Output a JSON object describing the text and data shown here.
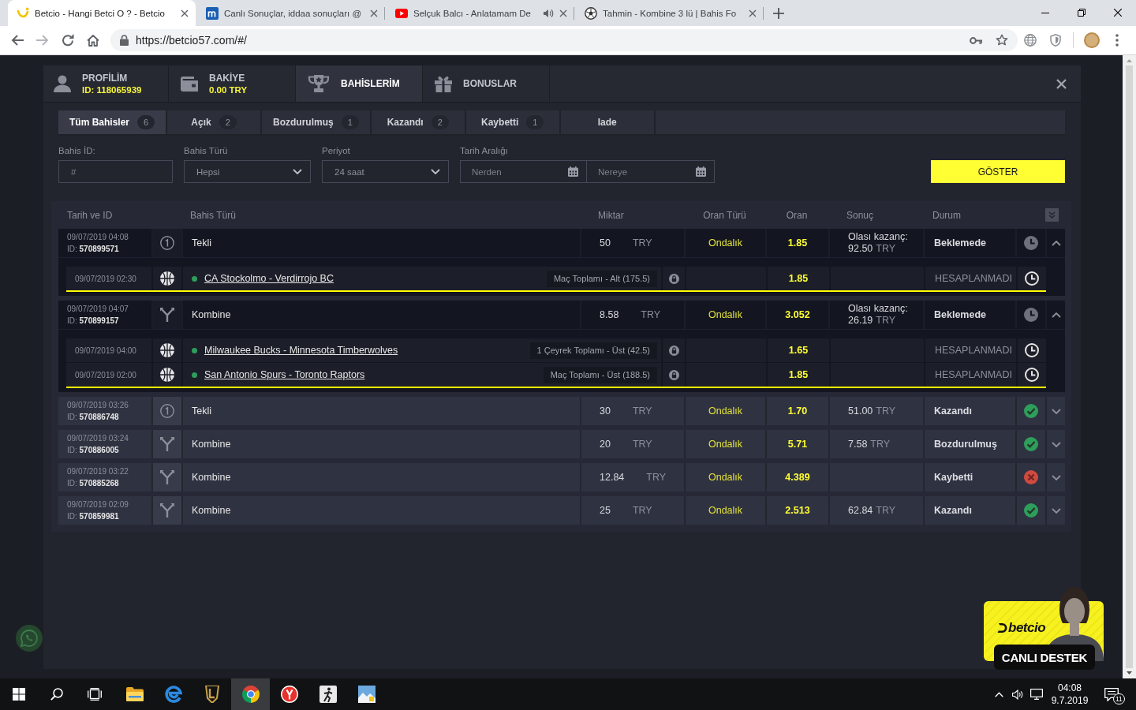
{
  "browser": {
    "tabs": [
      {
        "title": "Betcio - Hangi Betci O ? - Betcio",
        "selected": true,
        "audio": false
      },
      {
        "title": "Canlı Sonuçlar, iddaa sonuçları @",
        "selected": false,
        "audio": false
      },
      {
        "title": "Selçuk Balcı - Anlatamam De",
        "selected": false,
        "audio": true
      },
      {
        "title": "Tahmin - Kombine 3 lü | Bahis Fo",
        "selected": false,
        "audio": false
      }
    ],
    "url": "https://betcio57.com/#/"
  },
  "modal": {
    "nav": [
      {
        "label": "PROFİLİM",
        "detail": "ID: 118065939",
        "selected": false
      },
      {
        "label": "BAKİYE",
        "detail": "0.00 TRY",
        "selected": false
      },
      {
        "label": "BAHİSLERİM",
        "selected": true
      },
      {
        "label": "BONUSLAR",
        "selected": false
      }
    ],
    "bet_tabs": [
      {
        "label": "Tüm Bahisler",
        "count": "6",
        "selected": true
      },
      {
        "label": "Açık",
        "count": "2",
        "selected": false
      },
      {
        "label": "Bozdurulmuş",
        "count": "1",
        "selected": false
      },
      {
        "label": "Kazandı",
        "count": "2",
        "selected": false
      },
      {
        "label": "Kaybetti",
        "count": "1",
        "selected": false
      },
      {
        "label": "Iade",
        "selected": false
      }
    ],
    "filters": {
      "bet_id": {
        "label": "Bahis İD:",
        "placeholder": "#"
      },
      "bet_type": {
        "label": "Bahis Türü",
        "value": "Hepsi"
      },
      "period": {
        "label": "Periyot",
        "value": "24 saat"
      },
      "date_range": {
        "label": "Tarih Aralığı",
        "from_placeholder": "Nerden",
        "to_placeholder": "Nereye"
      },
      "show_button": "GÖSTER"
    },
    "table": {
      "columns": [
        "Tarih ve ID",
        "Bahis Türü",
        "Miktar",
        "Oran Türü",
        "Oran",
        "Sonuç",
        "Durum"
      ],
      "rows": [
        {
          "date": "09/07/2019 04:08",
          "id": "ID: **570899571**",
          "kind": "single",
          "type": "Tekli",
          "amount": "50",
          "currency": "TRY",
          "odds_type": "Ondalık",
          "odds": "1.85",
          "result": {
            "label": "Olası kazanç:",
            "amount": "92.50",
            "currency": "TRY"
          },
          "status": {
            "text": "Beklemede",
            "kind": "pending"
          },
          "expanded": true,
          "selections": [
            {
              "date": "09/07/2019 02:30",
              "match": "CA Stockolmo - Verdirrojo BC",
              "market": "Maç Toplamı - Alt (175.5)",
              "odds": "1.85",
              "status": "HESAPLANMADI"
            }
          ]
        },
        {
          "date": "09/07/2019 04:07",
          "id": "ID: **570899157**",
          "kind": "combo",
          "type": "Kombine",
          "amount": "8.58",
          "currency": "TRY",
          "odds_type": "Ondalık",
          "odds": "3.052",
          "result": {
            "label": "Olası kazanç:",
            "amount": "26.19",
            "currency": "TRY"
          },
          "status": {
            "text": "Beklemede",
            "kind": "pending"
          },
          "expanded": true,
          "selections": [
            {
              "date": "09/07/2019 04:00",
              "match": "Milwaukee Bucks - Minnesota Timberwolves",
              "market": "1 Çeyrek Toplamı - Üst (42.5)",
              "odds": "1.65",
              "status": "HESAPLANMADI"
            },
            {
              "date": "09/07/2019 02:00",
              "match": "San Antonio Spurs - Toronto Raptors",
              "market": "Maç Toplamı - Üst (188.5)",
              "odds": "1.85",
              "status": "HESAPLANMADI"
            }
          ]
        },
        {
          "date": "09/07/2019 03:26",
          "id": "ID: **570886748**",
          "kind": "single",
          "type": "Tekli",
          "amount": "30",
          "currency": "TRY",
          "odds_type": "Ondalık",
          "odds": "1.70",
          "result": {
            "amount": "51.00",
            "currency": "TRY"
          },
          "status": {
            "text": "Kazandı",
            "kind": "won"
          },
          "expanded": false
        },
        {
          "date": "09/07/2019 03:24",
          "id": "ID: **570886005**",
          "kind": "combo",
          "type": "Kombine",
          "amount": "20",
          "currency": "TRY",
          "odds_type": "Ondalık",
          "odds": "5.71",
          "result": {
            "amount": "7.58",
            "currency": "TRY"
          },
          "status": {
            "text": "Bozdurulmuş",
            "kind": "won"
          },
          "expanded": false
        },
        {
          "date": "09/07/2019 03:22",
          "id": "ID: **570885268**",
          "kind": "combo",
          "type": "Kombine",
          "amount": "12.84",
          "currency": "TRY",
          "odds_type": "Ondalık",
          "odds": "4.389",
          "status": {
            "text": "Kaybetti",
            "kind": "lost"
          },
          "expanded": false
        },
        {
          "date": "09/07/2019 02:09",
          "id": "ID: **570859981**",
          "kind": "combo",
          "type": "Kombine",
          "amount": "25",
          "currency": "TRY",
          "odds_type": "Ondalık",
          "odds": "2.513",
          "result": {
            "amount": "62.84",
            "currency": "TRY"
          },
          "status": {
            "text": "Kazandı",
            "kind": "won"
          },
          "expanded": false
        }
      ]
    }
  },
  "chat_widget": {
    "brand": "betcio",
    "label": "CANLI DESTEK"
  },
  "taskbar": {
    "apps": [
      {
        "selected": false
      },
      {
        "selected": false
      },
      {
        "selected": false
      },
      {
        "selected": true
      },
      {
        "selected": false
      },
      {
        "selected": false
      },
      {
        "selected": false
      }
    ],
    "time": "04:08",
    "date": "9.7.2019",
    "notifications": "11"
  }
}
